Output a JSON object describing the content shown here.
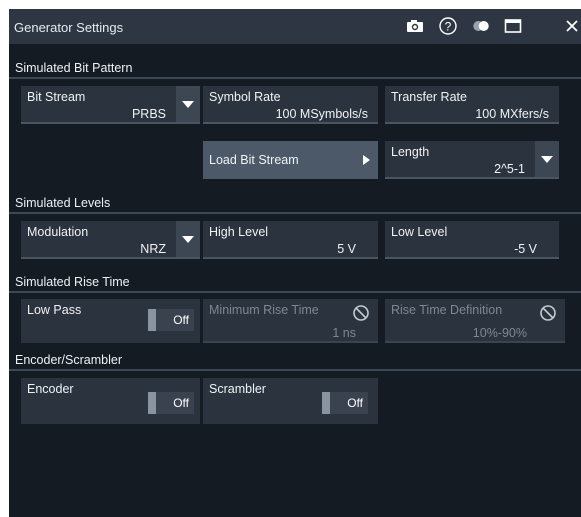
{
  "dialog": {
    "title": "Generator Settings",
    "icons": [
      "camera-icon",
      "help-icon",
      "theme-toggle-icon",
      "maximize-icon",
      "close-icon"
    ]
  },
  "sections": {
    "bit_pattern": "Simulated Bit Pattern",
    "levels": "Simulated Levels",
    "rise_time": "Simulated Rise Time",
    "encoder": "Encoder/Scrambler"
  },
  "bit_stream": {
    "label": "Bit Stream",
    "value": "PRBS"
  },
  "symbol_rate": {
    "label": "Symbol Rate",
    "value": "100 MSymbols/s"
  },
  "transfer_rate": {
    "label": "Transfer Rate",
    "value": "100 MXfers/s"
  },
  "load_bit_stream": {
    "label": "Load Bit Stream"
  },
  "length": {
    "label": "Length",
    "value": "2^5-1"
  },
  "modulation": {
    "label": "Modulation",
    "value": "NRZ"
  },
  "high_level": {
    "label": "High Level",
    "value": "5 V"
  },
  "low_level": {
    "label": "Low Level",
    "value": "-5 V"
  },
  "low_pass": {
    "label": "Low Pass",
    "state": "Off"
  },
  "min_rise_time": {
    "label": "Minimum Rise Time",
    "value": "1 ns"
  },
  "rise_time_def": {
    "label": "Rise Time Definition",
    "value": "10%-90%"
  },
  "encoder": {
    "label": "Encoder",
    "state": "Off"
  },
  "scrambler": {
    "label": "Scrambler",
    "state": "Off"
  },
  "colors": {
    "background": "#141b22",
    "titlebar": "#2d3642",
    "field": "#2a333e",
    "button": "#4c5968",
    "text": "#f0f3f6",
    "disabled_text": "#7f8892"
  }
}
